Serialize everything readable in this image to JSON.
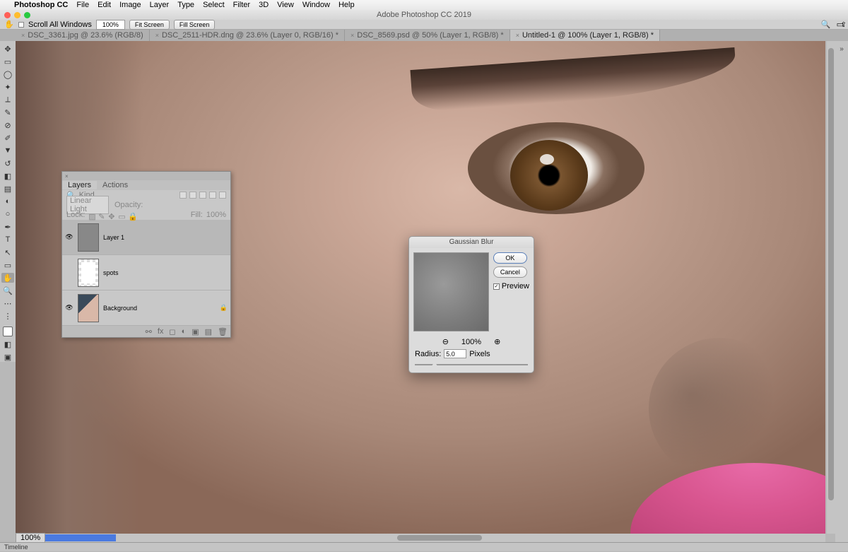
{
  "menubar": {
    "appname": "Photoshop CC",
    "items": [
      "File",
      "Edit",
      "Image",
      "Layer",
      "Type",
      "Select",
      "Filter",
      "3D",
      "View",
      "Window",
      "Help"
    ]
  },
  "window_title": "Adobe Photoshop CC 2019",
  "options_bar": {
    "scroll_all": "Scroll All Windows",
    "zoom": "100%",
    "fit": "Fit Screen",
    "fill": "Fill Screen"
  },
  "tabs": [
    {
      "label": "DSC_3361.jpg @ 23.6% (RGB/8)",
      "active": false
    },
    {
      "label": "DSC_2511-HDR.dng @ 23.6% (Layer 0, RGB/16) *",
      "active": false
    },
    {
      "label": "DSC_8569.psd @ 50% (Layer 1, RGB/8) *",
      "active": false
    },
    {
      "label": "Untitled-1 @ 100% (Layer 1, RGB/8) *",
      "active": true
    }
  ],
  "layers_panel": {
    "tabs": [
      "Layers",
      "Actions"
    ],
    "filter_label": "Kind",
    "blend_mode": "Linear Light",
    "opacity_label": "Opacity:",
    "opacity_value": "",
    "lock_label": "Lock:",
    "fill_label": "Fill:",
    "fill_value": "100%",
    "layers": [
      {
        "name": "Layer 1",
        "visible": true,
        "selected": true,
        "locked": false,
        "thumb": "gray"
      },
      {
        "name": "spots",
        "visible": false,
        "selected": false,
        "locked": false,
        "thumb": "spots"
      },
      {
        "name": "Background",
        "visible": true,
        "selected": false,
        "locked": true,
        "thumb": "bg"
      }
    ]
  },
  "dialog": {
    "title": "Gaussian Blur",
    "ok": "OK",
    "cancel": "Cancel",
    "preview_label": "Preview",
    "preview_checked": true,
    "zoom": "100%",
    "radius_label": "Radius:",
    "radius_value": "5.0",
    "radius_unit": "Pixels"
  },
  "footer": {
    "zoom": "100%",
    "timeline": "Timeline"
  }
}
